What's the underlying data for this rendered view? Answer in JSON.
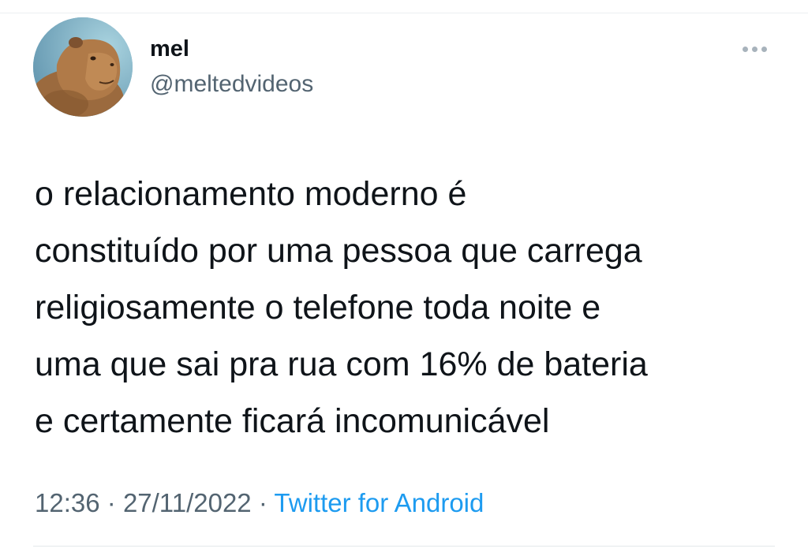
{
  "user": {
    "display_name": "mel",
    "handle": "@meltedvideos",
    "avatar_icon": "capybara-avatar"
  },
  "tweet": {
    "text": "o relacionamento moderno é\nconstituído por uma pessoa que carrega\nreligiosamente o telefone toda noite e\numa que sai pra rua com 16% de bateria\ne certamente ficará incomunicável",
    "time": "12:36",
    "date": "27/11/2022",
    "separator": "·",
    "source": "Twitter for Android"
  },
  "colors": {
    "text_primary": "#0f1419",
    "text_secondary": "#536471",
    "link": "#1d9bf0"
  },
  "icons": {
    "more": "more-dots-icon"
  }
}
